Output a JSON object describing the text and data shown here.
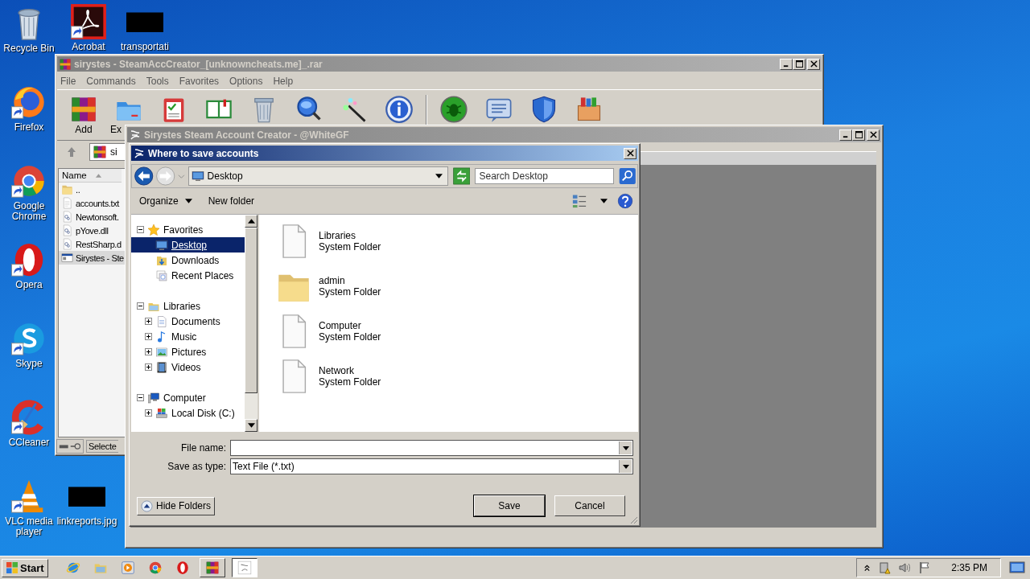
{
  "desktop": {
    "icons": [
      {
        "label": "Recycle Bin",
        "kind": "recycle",
        "shortcut": false
      },
      {
        "label": "Acrobat",
        "kind": "acrobat",
        "shortcut": true
      },
      {
        "label": "transportati",
        "kind": "thumb",
        "shortcut": false
      },
      {
        "label": "Firefox",
        "kind": "firefox",
        "shortcut": true
      },
      {
        "label": "Google Chrome",
        "kind": "chrome",
        "shortcut": true
      },
      {
        "label": "Opera",
        "kind": "opera",
        "shortcut": true
      },
      {
        "label": "Skype",
        "kind": "skype",
        "shortcut": true
      },
      {
        "label": "CCleaner",
        "kind": "ccleaner",
        "shortcut": true
      },
      {
        "label": "VLC media player",
        "kind": "vlc",
        "shortcut": true
      },
      {
        "label": "linkreports.jpg",
        "kind": "thumb",
        "shortcut": false
      }
    ]
  },
  "archive_window": {
    "title": "sirystes - SteamAccCreator_[unknowncheats.me]_.rar",
    "menu": [
      "File",
      "Commands",
      "Tools",
      "Favorites",
      "Options",
      "Help"
    ],
    "toolbar": [
      {
        "kind": "add",
        "label": "Add"
      },
      {
        "kind": "extract",
        "label": "Ex"
      },
      {
        "kind": "test"
      },
      {
        "kind": "view"
      },
      {
        "kind": "delete"
      },
      {
        "kind": "find"
      },
      {
        "kind": "wizard"
      },
      {
        "kind": "info"
      },
      {
        "kind": "virus"
      },
      {
        "kind": "comment"
      },
      {
        "kind": "protect"
      },
      {
        "kind": "sfx"
      }
    ],
    "address": "si",
    "column": "Name",
    "files": [
      {
        "name": "..",
        "kind": "up",
        "selected": false
      },
      {
        "name": "accounts.txt",
        "kind": "txt",
        "selected": false
      },
      {
        "name": "Newtonsoft.",
        "kind": "dll",
        "selected": false
      },
      {
        "name": "pYove.dll",
        "kind": "dll",
        "selected": false
      },
      {
        "name": "RestSharp.d",
        "kind": "dll",
        "selected": false
      },
      {
        "name": "Sirystes - Ste",
        "kind": "exe",
        "selected": true
      }
    ],
    "status": "Selecte"
  },
  "app_window": {
    "title": "Sirystes Steam Account Creator - @WhiteGF"
  },
  "dialog": {
    "title": "Where to save accounts",
    "location": "Desktop",
    "search_placeholder": "Search Desktop",
    "toolbar": [
      "Organize",
      "New folder"
    ],
    "tree": [
      {
        "label": "Favorites",
        "kind": "star",
        "expanded": true,
        "selected": false,
        "children": [
          {
            "label": "Desktop",
            "kind": "desktop",
            "selected": true
          },
          {
            "label": "Downloads",
            "kind": "downloads",
            "selected": false
          },
          {
            "label": "Recent Places",
            "kind": "recent",
            "selected": false
          }
        ]
      },
      {
        "label": "Libraries",
        "kind": "libraries",
        "expanded": true,
        "selected": false,
        "children": [
          {
            "label": "Documents",
            "kind": "documents",
            "expanded": false,
            "selected": false
          },
          {
            "label": "Music",
            "kind": "music",
            "expanded": false,
            "selected": false
          },
          {
            "label": "Pictures",
            "kind": "pictures",
            "expanded": false,
            "selected": false
          },
          {
            "label": "Videos",
            "kind": "videos",
            "expanded": false,
            "selected": false
          }
        ]
      },
      {
        "label": "Computer",
        "kind": "computer",
        "expanded": true,
        "selected": false,
        "children": [
          {
            "label": "Local Disk (C:)",
            "kind": "disk",
            "expanded": false,
            "selected": false
          }
        ]
      }
    ],
    "items": [
      {
        "name": "Libraries",
        "type": "System Folder",
        "kind": "file"
      },
      {
        "name": "admin",
        "type": "System Folder",
        "kind": "folder"
      },
      {
        "name": "Computer",
        "type": "System Folder",
        "kind": "file"
      },
      {
        "name": "Network",
        "type": "System Folder",
        "kind": "file"
      }
    ],
    "file_name": {
      "label": "File name:"
    },
    "save_type": {
      "label": "Save as type:",
      "value": "Text File (*.txt)"
    },
    "hide_folders": "Hide Folders",
    "buttons": [
      "Save",
      "Cancel"
    ]
  },
  "taskbar": {
    "start": "Start",
    "apps": [
      {
        "kind": "ie",
        "active": false
      },
      {
        "kind": "explorer",
        "active": false
      },
      {
        "kind": "media",
        "active": false
      },
      {
        "kind": "chrome",
        "active": false
      },
      {
        "kind": "opera",
        "active": false
      },
      {
        "kind": "winrar",
        "active": false
      },
      {
        "kind": "creator",
        "active": true
      }
    ],
    "clock": "2:35 PM"
  }
}
